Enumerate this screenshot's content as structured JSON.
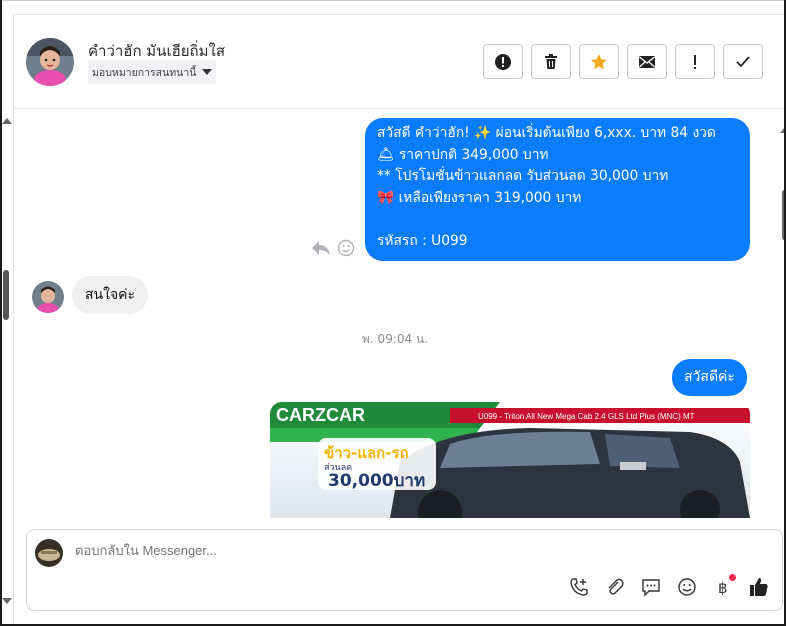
{
  "header": {
    "contact_name": "คำว่าฮัก มันเฮียถิ่มใส",
    "assign_label": "มอบหมายการสนทนานี้",
    "actions": [
      "spam",
      "delete",
      "star",
      "mark-unread",
      "follow-up",
      "done"
    ]
  },
  "messages": {
    "outgoing_1": {
      "lines": [
        "สวัสดี คำว่าฮัก! ✨  ผ่อนเริ่มต้นเพียง 6,xxx. บาท 84 งวด",
        "🛎 ราคาปกติ 349,000 บาท",
        "** โปรโมชั่นข้าวแลกลด รับส่วนลด 30,000 บาท",
        "🎀  เหลือเพียงราคา 319,000 บาท",
        "",
        "รหัสรถ : U099"
      ]
    },
    "incoming_1": "สนใจค่ะ",
    "timestamp": "พ. 09:04 น.",
    "outgoing_2": "สวัสดีค่ะ",
    "image": {
      "banner_text": "U099 - Triton All New Mega Cab 2.4 GLS Ltd Plus (MNC) MT",
      "promo_line1": "ข้าว-แลก-รถ",
      "promo_line2": "ส่วนลด",
      "promo_amount": "30,000บาท",
      "brand_text": "CARZCAR"
    }
  },
  "composer": {
    "placeholder": "ตอบกลับใน Messenger...",
    "tools": [
      "call-add",
      "attachment",
      "saved-reply",
      "emoji",
      "payment",
      "like"
    ]
  },
  "colors": {
    "accent": "#0a7cff",
    "incoming_bg": "#f0f0f0",
    "star": "#f5a623",
    "notification_dot": "#f0284a"
  }
}
